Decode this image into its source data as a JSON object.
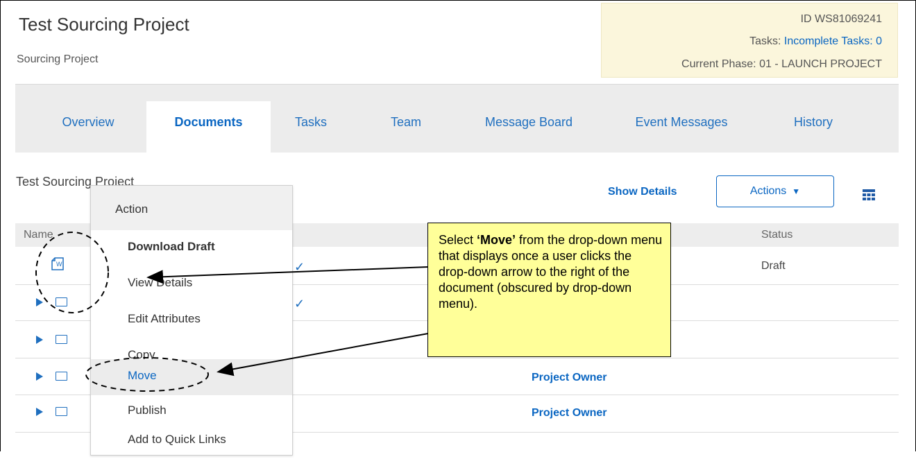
{
  "header": {
    "title": "Test Sourcing Project",
    "subtitle": "Sourcing Project"
  },
  "info": {
    "id": "ID WS81069241",
    "tasks_label": "Tasks:",
    "tasks_link": "Incomplete Tasks: 0",
    "phase_label": "Current Phase:",
    "phase_value": "01 - LAUNCH PROJECT"
  },
  "tabs": [
    {
      "label": "Overview"
    },
    {
      "label": "Documents",
      "active": true
    },
    {
      "label": "Tasks"
    },
    {
      "label": "Team"
    },
    {
      "label": "Message Board"
    },
    {
      "label": "Event Messages"
    },
    {
      "label": "History"
    }
  ],
  "section": {
    "title": "Test Sourcing Project",
    "show_details": "Show Details",
    "actions_label": "Actions",
    "actions_arrow": "▼"
  },
  "table": {
    "columns": [
      "Name",
      "Status"
    ],
    "rows": [
      {
        "type": "document",
        "status": "Draft",
        "owner": "",
        "checked": true
      },
      {
        "type": "folder",
        "status": "",
        "owner": "",
        "checked": true
      },
      {
        "type": "folder",
        "status": "",
        "owner": "",
        "checked": false
      },
      {
        "type": "folder",
        "status": "",
        "owner": "",
        "checked": false
      },
      {
        "type": "folder",
        "status": "",
        "owner": "Project Owner",
        "checked": false
      },
      {
        "type": "folder",
        "status": "",
        "owner": "Project Owner",
        "checked": false
      }
    ]
  },
  "menu": {
    "header": "Action",
    "items": [
      {
        "label": "Download Draft",
        "bold": true
      },
      {
        "label": "View Details"
      },
      {
        "label": "Edit Attributes"
      },
      {
        "label": "Copy"
      },
      {
        "label": "Move",
        "highlighted": true
      },
      {
        "label": "Publish"
      },
      {
        "label": "Add to Quick Links"
      }
    ]
  },
  "callout": {
    "pre": "Select ",
    "bold": "‘Move’",
    "post": " from the drop-down menu that displays once a user clicks the drop-down arrow to the right of the document (obscured by drop-down menu)."
  },
  "icons": {
    "doc": "word-document-icon",
    "folder": "folder-icon",
    "expand": "expand-triangle-icon",
    "grid": "grid-view-icon",
    "check": "checkmark-icon"
  },
  "colors": {
    "accent": "#0a66c2",
    "info_bg": "#fbf6dc",
    "callout_bg": "#ffff99",
    "tabbar_bg": "#ececec"
  }
}
